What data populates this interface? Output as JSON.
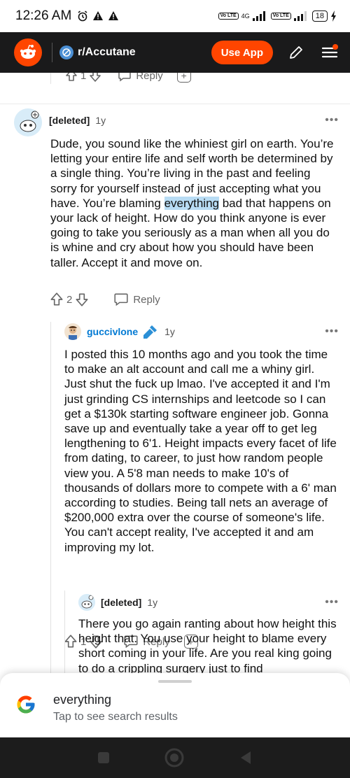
{
  "status_bar": {
    "time": "12:26 AM",
    "network": "4G",
    "volte1": "Vo LTE",
    "volte2": "Vo LTE",
    "battery": "18"
  },
  "header": {
    "subreddit": "r/Accutane",
    "use_app_label": "Use App"
  },
  "previous_actions": {
    "vote_count": "1",
    "reply_label": "Reply"
  },
  "comments": [
    {
      "username": "[deleted]",
      "age": "1y",
      "text_before": "Dude, you sound like the whiniest girl on earth. You’re letting your entire life and self worth be determined by a single thing. You’re living in the past and feeling sorry for yourself instead of just accepting what you have. You’re blaming ",
      "highlight": "everything",
      "text_after": " bad that happens on your lack of height. How do you think anyone is ever going to take you seriously as a man when all you do is whine and cry about how you should have been taller. Accept it and move on.",
      "vote_count": "2",
      "reply_label": "Reply"
    },
    {
      "username": "guccivlone",
      "age": "1y",
      "text": "I posted this 10 months ago and you took the time to make an alt account and call me a whiny girl. Just shut the fuck up lmao. I've accepted it and I'm just grinding CS internships and leetcode so I can get a $130k starting software engineer job. Gonna save up and eventually take a year off to get leg lengthening to 6'1. Height impacts every facet of life from dating, to career, to just how random people view you. A 5'8 man needs to make 10's of thousands of dollars more to compete with a 6' man according to studies. Being tall nets an average of $200,000 extra over the course of someone's life. You can't accept reality, I've accepted it and am improving my lot.",
      "vote_count": "1",
      "reply_label": "Reply"
    },
    {
      "username": "[deleted]",
      "age": "1y",
      "text": "There you go again ranting about how height this height that. You use your height to blame every short coming in your life. Are you real king going to do a crippling surgery just to find"
    }
  ],
  "search_sheet": {
    "query": "everything",
    "hint": "Tap to see search results"
  },
  "colors": {
    "reddit_orange": "#ff4500",
    "header_bg": "#1a1a1b",
    "link_blue": "#0079d3",
    "highlight": "#b8dcf4"
  }
}
